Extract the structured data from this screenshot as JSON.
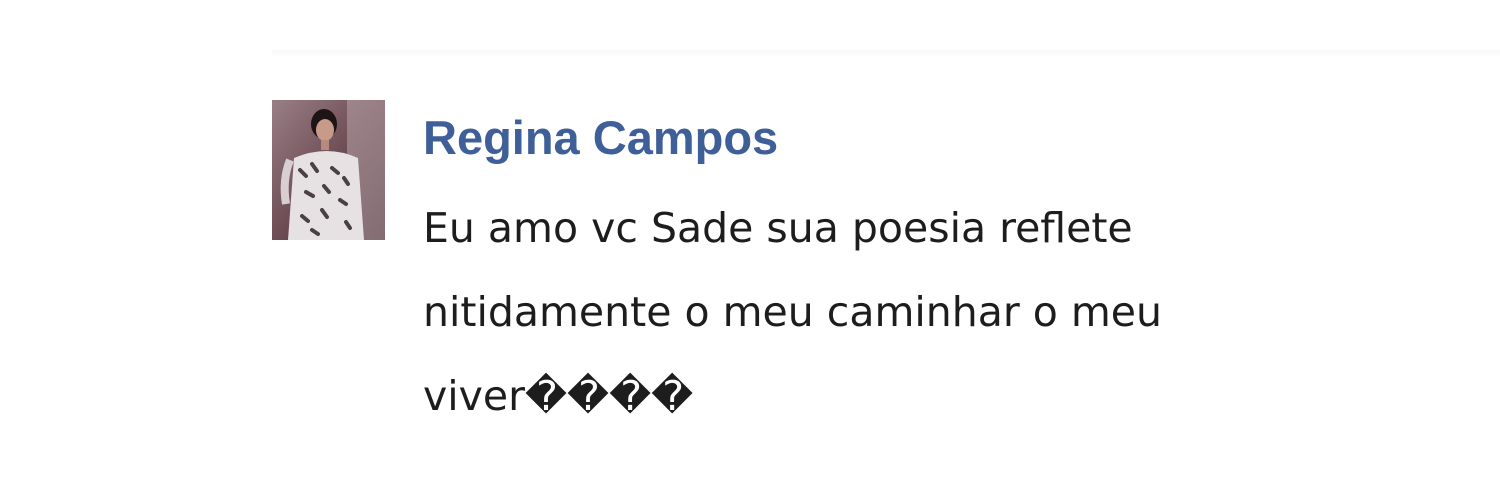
{
  "comment": {
    "author": {
      "name": "Regina Campos",
      "avatar_icon": "profile-photo"
    },
    "text": "Eu amo vc Sade sua poesia reflete\nnitidamente o meu caminhar o meu\nviver����"
  },
  "colors": {
    "author_name": "#3f5f98",
    "comment_text": "#1d1d1d",
    "background": "#ffffff"
  }
}
